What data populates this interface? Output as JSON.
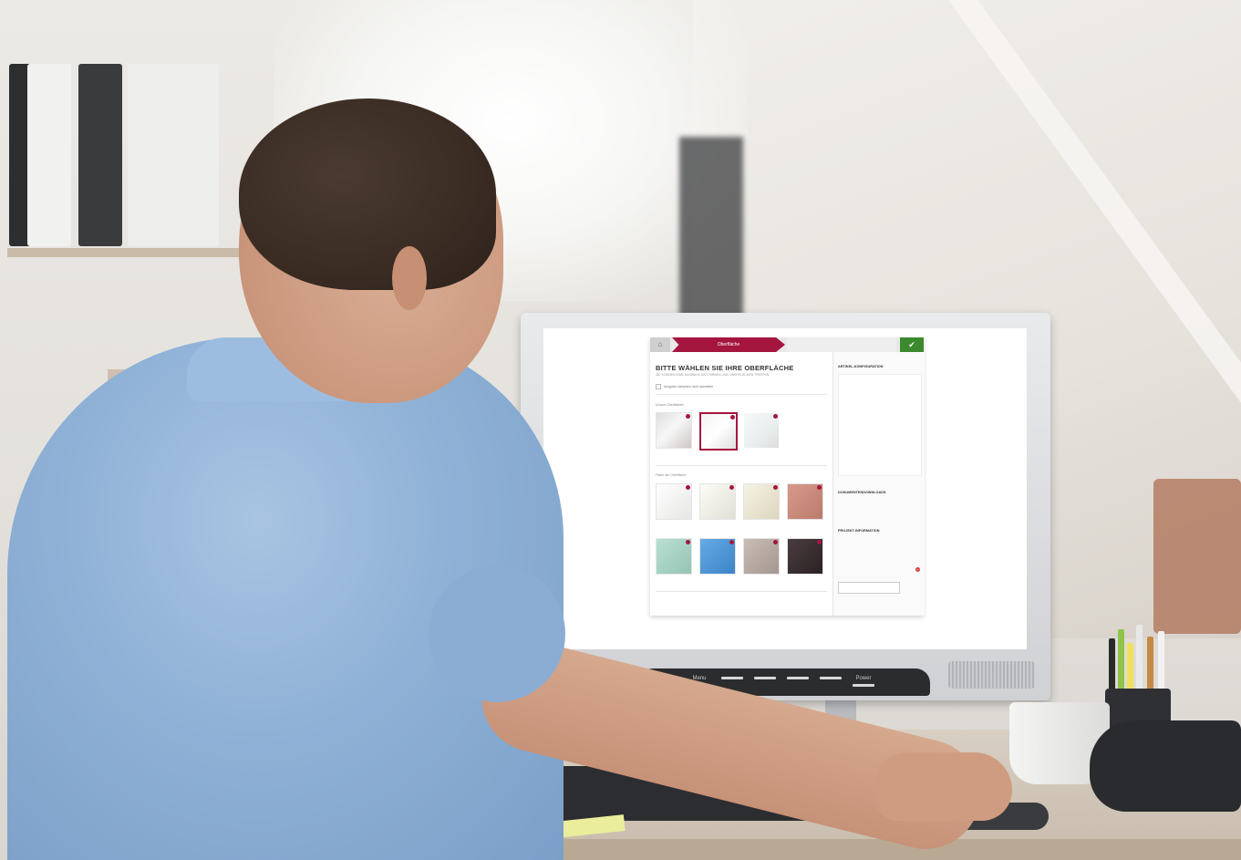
{
  "app": {
    "stepper": {
      "home_icon": "home-icon",
      "active_step": "Oberfläche",
      "next_step": "",
      "done_icon": "check-icon"
    },
    "heading": "BITTE WÄHLEN SIE IHRE OBERFLÄCHE",
    "subheading": "SIE KÖNNEN EINE AUSWAHL AUS FARBEN UND OBERFLÄCHEN TREFFEN",
    "checkbox_label": "Ausgabe-Varianten nicht darstellen",
    "section1_label": "Unsere Oberflächen",
    "surfaces": [
      {
        "label": "",
        "selected": false
      },
      {
        "label": "",
        "selected": true
      },
      {
        "label": "",
        "selected": false
      }
    ],
    "section2_label": "Farbe der Oberfläche",
    "colors": [
      {
        "label": "",
        "hex": "#f4f4f2"
      },
      {
        "label": "",
        "hex": "#efeee6"
      },
      {
        "label": "",
        "hex": "#ece8d8"
      },
      {
        "label": "",
        "hex": "#c98a7b"
      },
      {
        "label": "",
        "hex": "#a8d4c4"
      },
      {
        "label": "",
        "hex": "#4f97d6"
      },
      {
        "label": "",
        "hex": "#b8aba4"
      },
      {
        "label": "",
        "hex": "#3a2f31"
      }
    ],
    "sidebar": {
      "config_title": "ARTIKEL-KONFIGURATION",
      "config_sub": "",
      "save_link": "",
      "docs_title": "DOKUMENTENDOWNLOADS",
      "docs_links": [
        "",
        "",
        ""
      ],
      "project_title": "PROJEKT-INFORMATION",
      "project_sub": "",
      "item1": "",
      "item2": "",
      "cta_label": ""
    },
    "accent": "#a5163e"
  },
  "monitor_buttons": [
    "Menu",
    "",
    "",
    "",
    "",
    "Power"
  ]
}
